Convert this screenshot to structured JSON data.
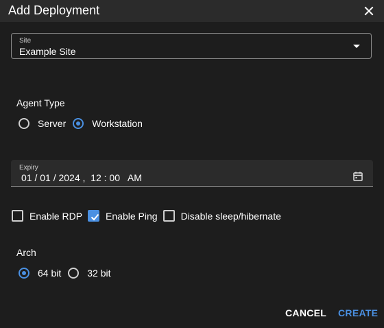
{
  "dialog": {
    "title": "Add Deployment"
  },
  "site": {
    "label": "Site",
    "value": "Example Site"
  },
  "agent_type": {
    "label": "Agent Type",
    "options": [
      {
        "label": "Server",
        "selected": false
      },
      {
        "label": "Workstation",
        "selected": true
      }
    ]
  },
  "expiry": {
    "label": "Expiry",
    "value": "01 / 01 / 2024 ,  12 : 00   AM"
  },
  "checkboxes": [
    {
      "label": "Enable RDP",
      "checked": false
    },
    {
      "label": "Enable Ping",
      "checked": true
    },
    {
      "label": "Disable sleep/hibernate",
      "checked": false
    }
  ],
  "arch": {
    "label": "Arch",
    "options": [
      {
        "label": "64 bit",
        "selected": true
      },
      {
        "label": "32 bit",
        "selected": false
      }
    ]
  },
  "actions": {
    "cancel": "CANCEL",
    "create": "CREATE"
  },
  "colors": {
    "background": "#1d1d1d",
    "titlebar": "#2b2b2b",
    "accent": "#4a90e2"
  },
  "icons": {
    "close": "close-icon",
    "dropdown": "chevron-down-icon",
    "calendar": "calendar-icon",
    "check": "check-icon"
  }
}
